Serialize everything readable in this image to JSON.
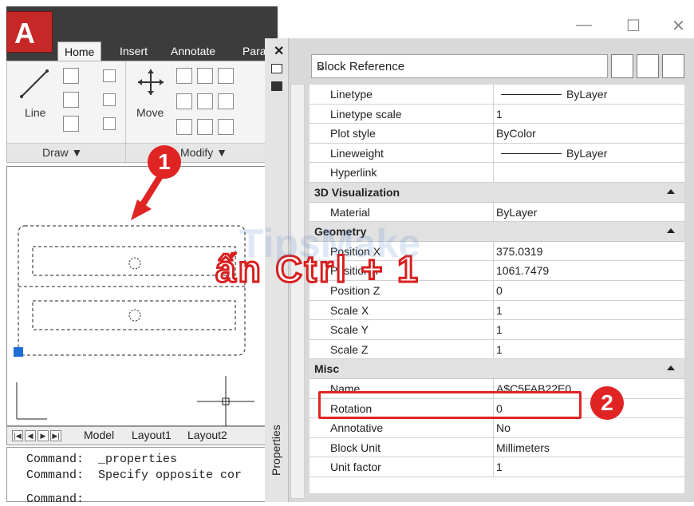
{
  "window": {
    "minimize": "—",
    "maximize": "☐",
    "close": "✕"
  },
  "app": {
    "logo": "A"
  },
  "ribbon": {
    "tabs": [
      "Home",
      "Insert",
      "Annotate",
      "Para"
    ],
    "draw_panel": "Draw ▼",
    "modify_panel": "Modify ▼",
    "line_label": "Line",
    "move_label": "Move"
  },
  "layout_tabs": [
    "Model",
    "Layout1",
    "Layout2"
  ],
  "command_lines": [
    "Command:  _properties",
    "Command:  Specify opposite cor",
    "Command:"
  ],
  "palette": {
    "title": "Properties",
    "close": "✕",
    "selection": "Block Reference",
    "rows_top": [
      {
        "k": "Linetype",
        "v": "ByLayer",
        "line": true
      },
      {
        "k": "Linetype scale",
        "v": "1"
      },
      {
        "k": "Plot style",
        "v": "ByColor"
      },
      {
        "k": "Lineweight",
        "v": "ByLayer",
        "line": true
      },
      {
        "k": "Hyperlink",
        "v": ""
      }
    ],
    "cat_3d": "3D Visualization",
    "rows_3d": [
      {
        "k": "Material",
        "v": "ByLayer"
      }
    ],
    "cat_geo": "Geometry",
    "rows_geo": [
      {
        "k": "Position X",
        "v": "375.0319"
      },
      {
        "k": "Position Y",
        "v": "1061.7479"
      },
      {
        "k": "Position Z",
        "v": "0"
      },
      {
        "k": "Scale X",
        "v": "1"
      },
      {
        "k": "Scale Y",
        "v": "1"
      },
      {
        "k": "Scale Z",
        "v": "1"
      }
    ],
    "cat_misc": "Misc",
    "rows_misc": [
      {
        "k": "Name",
        "v": "A$C5FAB22E0"
      },
      {
        "k": "Rotation",
        "v": "0"
      },
      {
        "k": "Annotative",
        "v": "No"
      },
      {
        "k": "Block Unit",
        "v": "Millimeters"
      },
      {
        "k": "Unit factor",
        "v": "1"
      }
    ]
  },
  "annotations": {
    "step1": "1",
    "step2": "2",
    "overlay": "ấn Ctrl + 1",
    "watermark": "TipsMake"
  }
}
